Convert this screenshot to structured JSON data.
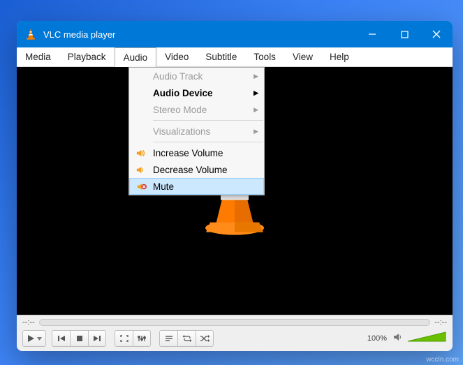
{
  "titlebar": {
    "title": "VLC media player"
  },
  "menubar": {
    "items": [
      "Media",
      "Playback",
      "Audio",
      "Video",
      "Subtitle",
      "Tools",
      "View",
      "Help"
    ],
    "open_index": 2
  },
  "audio_menu": {
    "items": [
      {
        "label": "Audio Track",
        "enabled": false,
        "submenu": true
      },
      {
        "label": "Audio Device",
        "enabled": true,
        "submenu": true,
        "bold": true
      },
      {
        "label": "Stereo Mode",
        "enabled": false,
        "submenu": true
      },
      {
        "sep": true
      },
      {
        "label": "Visualizations",
        "enabled": false,
        "submenu": true
      },
      {
        "sep": true
      },
      {
        "label": "Increase Volume",
        "enabled": true,
        "icon": "volume-up"
      },
      {
        "label": "Decrease Volume",
        "enabled": true,
        "icon": "volume-down"
      },
      {
        "label": "Mute",
        "enabled": true,
        "icon": "mute",
        "selected": true
      }
    ]
  },
  "controls": {
    "time_left": "--:--",
    "time_right": "--:--",
    "volume_pct": "100%"
  },
  "watermark": "wccln.com"
}
